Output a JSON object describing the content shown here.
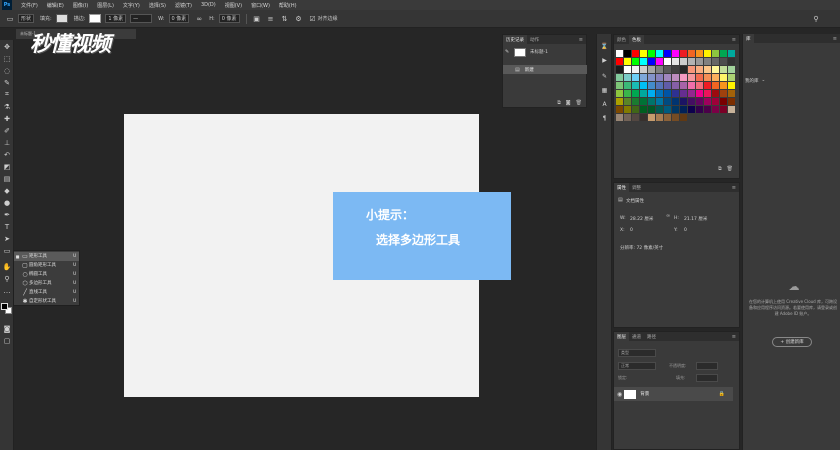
{
  "menu": {
    "app_badge": "Ps",
    "items": [
      "文件(F)",
      "编辑(E)",
      "图像(I)",
      "图层(L)",
      "文字(Y)",
      "选择(S)",
      "滤镜(T)",
      "3D(D)",
      "视图(V)",
      "窗口(W)",
      "帮助(H)"
    ]
  },
  "options": {
    "mode": "形状",
    "fill_label": "填充:",
    "stroke_label": "描边:",
    "stroke_width": "1 像素",
    "w_label": "W:",
    "w_value": "0 像素",
    "h_label": "H:",
    "h_value": "0 像素",
    "align_edges": "对齐边缘"
  },
  "document": {
    "tab_title": "未标题-1"
  },
  "watermark": "秒懂视频",
  "tip": {
    "title": "小提示：",
    "body": "选择多边形工具"
  },
  "flyout": {
    "items": [
      {
        "label": "矩形工具",
        "key": "U",
        "icon": "rectangle-icon",
        "active": true
      },
      {
        "label": "圆角矩形工具",
        "key": "U",
        "icon": "rounded-rectangle-icon",
        "active": false
      },
      {
        "label": "椭圆工具",
        "key": "U",
        "icon": "ellipse-icon",
        "active": false
      },
      {
        "label": "多边形工具",
        "key": "U",
        "icon": "polygon-icon",
        "active": false
      },
      {
        "label": "直线工具",
        "key": "U",
        "icon": "line-icon",
        "active": false
      },
      {
        "label": "自定形状工具",
        "key": "U",
        "icon": "custom-shape-icon",
        "active": false
      }
    ]
  },
  "history": {
    "tabs": [
      "历史记录",
      "动作"
    ],
    "snapshot": "未标题-1",
    "state": "新建"
  },
  "swatches": {
    "tabs": [
      "颜色",
      "色板"
    ],
    "colors": [
      "#ffffff",
      "#000000",
      "#ff0000",
      "#ffff00",
      "#00ff00",
      "#00ffff",
      "#0000ff",
      "#ff00ff",
      "#ed1c24",
      "#f26522",
      "#f7941d",
      "#fff200",
      "#8dc63f",
      "#00a651",
      "#00a99d",
      "#ff0000",
      "#ffff00",
      "#00ff00",
      "#00ffff",
      "#0000ff",
      "#ff00ff",
      "#ffffff",
      "#e6e6e6",
      "#cccccc",
      "#b3b3b3",
      "#999999",
      "#808080",
      "#666666",
      "#4d4d4d",
      "#333333",
      "#1a1a1a",
      "#ffffff",
      "#f2f2f2",
      "#cccccc",
      "#a6a6a6",
      "#808080",
      "#595959",
      "#404040",
      "#262626",
      "#f7977a",
      "#f9ad81",
      "#fdc68a",
      "#fff79a",
      "#c4df9b",
      "#a3d39c",
      "#82ca9c",
      "#7accc8",
      "#6dcff6",
      "#7da7d9",
      "#8393ca",
      "#8781bd",
      "#a186be",
      "#bd8cbf",
      "#f49ac1",
      "#f5989d",
      "#f26c4f",
      "#f68e56",
      "#fbaf5d",
      "#fff568",
      "#acd373",
      "#7cc576",
      "#3bb878",
      "#1abbb4",
      "#00bff3",
      "#438ccb",
      "#5574b9",
      "#605ca8",
      "#855fa8",
      "#a763a8",
      "#f06eaa",
      "#f26d7d",
      "#ed1c24",
      "#f26522",
      "#f7941d",
      "#fff200",
      "#8dc63f",
      "#39b54a",
      "#00a651",
      "#00a99d",
      "#00aeef",
      "#0072bc",
      "#0054a6",
      "#2e3192",
      "#662d91",
      "#92278f",
      "#ec008c",
      "#ed145b",
      "#9e0b0f",
      "#a0410d",
      "#a36209",
      "#aba000",
      "#598527",
      "#1a7b30",
      "#007236",
      "#00746b",
      "#0076a3",
      "#004b80",
      "#003471",
      "#1b1464",
      "#440e62",
      "#630460",
      "#9e005d",
      "#9e0039",
      "#790000",
      "#7b2e00",
      "#7d4900",
      "#827b00",
      "#406618",
      "#005e20",
      "#005826",
      "#005952",
      "#005b7f",
      "#003663",
      "#002157",
      "#0d004c",
      "#32004b",
      "#4b0049",
      "#7b0046",
      "#7a0026",
      "#c7b299",
      "#998675",
      "#736357",
      "#534741",
      "#37302d",
      "#c69c6d",
      "#a67c52",
      "#8c6239",
      "#754c24",
      "#603913"
    ]
  },
  "properties": {
    "tabs": [
      "属性",
      "调整"
    ],
    "section": "文档属性",
    "w_label": "W:",
    "w_value": "28.22 厘米",
    "h_label": "H:",
    "h_value": "21.17 厘米",
    "x_label": "X:",
    "x_value": "0",
    "y_label": "Y:",
    "y_value": "0",
    "resolution": "分辨率: 72 像素/英寸"
  },
  "layers": {
    "tabs": [
      "图层",
      "通道",
      "路径"
    ],
    "search": "类型",
    "blend": "正常",
    "opacity_label": "不透明度:",
    "lock_label": "锁定:",
    "fill_label": "填充:",
    "layer_name": "背景"
  },
  "libraries": {
    "tab": "库",
    "dropdown": "我的库",
    "description": "在您的计算机上使用 Creative Cloud 库，可跨设备和应用程序访问资源。若要使用库，请登录或创建 Adobe ID 账户。",
    "button": "+ 创建新库"
  }
}
